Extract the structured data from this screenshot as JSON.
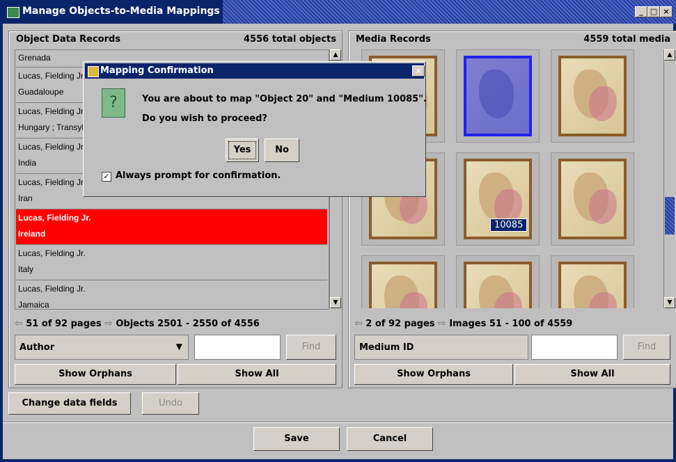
{
  "window": {
    "title": "Manage Objects-to-Media Mappings"
  },
  "left": {
    "header": "Object Data Records",
    "total": "4556 total objects",
    "rows": [
      {
        "line1": "Grenada",
        "line2": ""
      },
      {
        "line1": "Lucas, Fielding Jr.",
        "line2": "Guadaloupe"
      },
      {
        "line1": "Lucas, Fielding Jr.",
        "line2": "Hungary ; Transylvania"
      },
      {
        "line1": "Lucas, Fielding Jr.",
        "line2": "India"
      },
      {
        "line1": "Lucas, Fielding Jr.",
        "line2": "Iran"
      },
      {
        "line1": "Lucas, Fielding Jr.",
        "line2": "Ireland"
      },
      {
        "line1": "Lucas, Fielding Jr.",
        "line2": "Italy"
      },
      {
        "line1": "Lucas, Fielding Jr.",
        "line2": "Jamaica"
      }
    ],
    "pager": "51 of 92 pages",
    "range": "Objects 2501 - 2550 of 4556",
    "search_field": "Author",
    "find": "Find",
    "show_orphans": "Show Orphans",
    "show_all": "Show All"
  },
  "right": {
    "header": "Media Records",
    "total": "4559 total media",
    "hover_id": "10085",
    "pager": "2 of 92 pages",
    "range": "Images 51 - 100 of 4559",
    "search_field": "Medium ID",
    "find": "Find",
    "show_orphans": "Show Orphans",
    "show_all": "Show All"
  },
  "bottom": {
    "change_fields": "Change data fields",
    "undo": "Undo",
    "save": "Save",
    "cancel": "Cancel"
  },
  "dialog": {
    "title": "Mapping Confirmation",
    "message": "You are about to map \"Object 20\" and \"Medium 10085\".",
    "question": "Do you wish to proceed?",
    "yes": "Yes",
    "no": "No",
    "checkbox_label": "Always prompt for confirmation.",
    "checkbox_checked": true
  },
  "icons": {
    "question": "question-icon",
    "window": "app-icon"
  },
  "colors": {
    "title_bar": "#0a246a",
    "selection": "#ff0000",
    "panel": "#c0c0c0"
  }
}
